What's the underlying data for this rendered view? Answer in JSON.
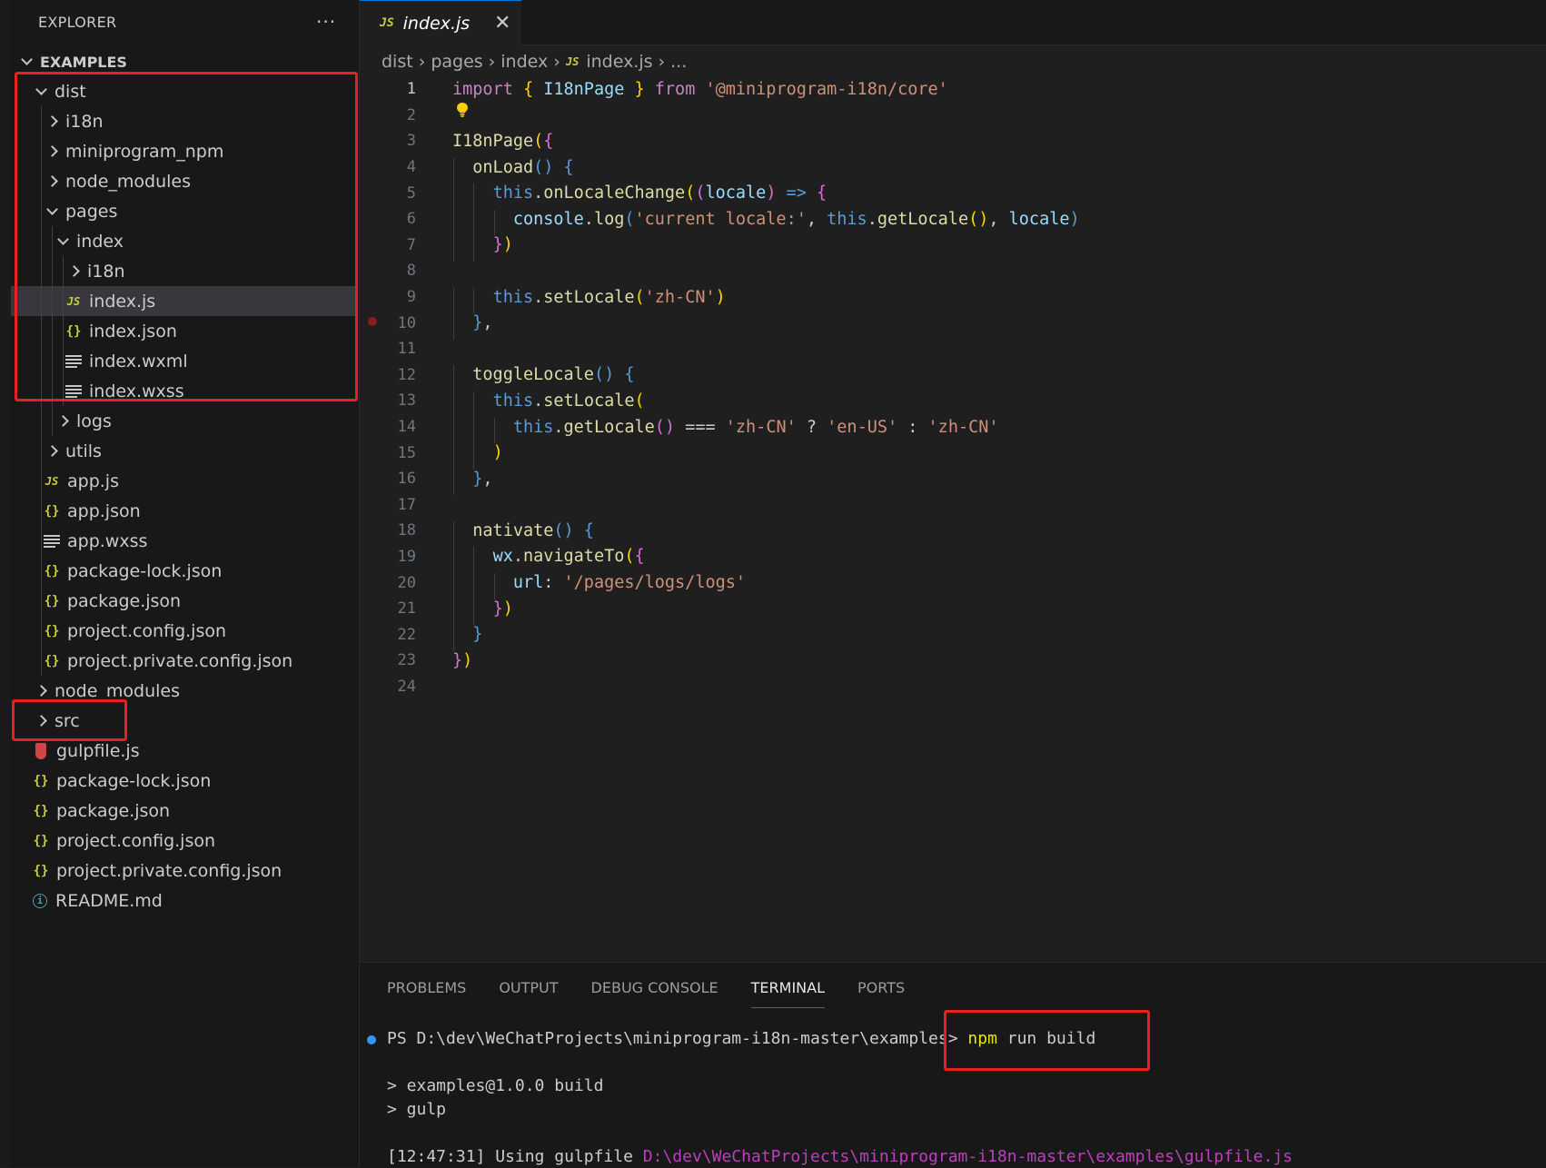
{
  "explorer": {
    "title": "EXPLORER",
    "more": "···",
    "workspace": "EXAMPLES"
  },
  "tree": [
    {
      "label": "dist",
      "depth": 0,
      "kind": "folder",
      "open": true
    },
    {
      "label": "i18n",
      "depth": 1,
      "kind": "folder",
      "open": false
    },
    {
      "label": "miniprogram_npm",
      "depth": 1,
      "kind": "folder",
      "open": false
    },
    {
      "label": "node_modules",
      "depth": 1,
      "kind": "folder",
      "open": false
    },
    {
      "label": "pages",
      "depth": 1,
      "kind": "folder",
      "open": true
    },
    {
      "label": "index",
      "depth": 2,
      "kind": "folder",
      "open": true
    },
    {
      "label": "i18n",
      "depth": 3,
      "kind": "folder",
      "open": false
    },
    {
      "label": "index.js",
      "depth": 3,
      "kind": "js",
      "selected": true
    },
    {
      "label": "index.json",
      "depth": 3,
      "kind": "json"
    },
    {
      "label": "index.wxml",
      "depth": 3,
      "kind": "lines"
    },
    {
      "label": "index.wxss",
      "depth": 3,
      "kind": "lines"
    },
    {
      "label": "logs",
      "depth": 2,
      "kind": "folder",
      "open": false
    },
    {
      "label": "utils",
      "depth": 1,
      "kind": "folder",
      "open": false
    },
    {
      "label": "app.js",
      "depth": 1,
      "kind": "js"
    },
    {
      "label": "app.json",
      "depth": 1,
      "kind": "json"
    },
    {
      "label": "app.wxss",
      "depth": 1,
      "kind": "lines"
    },
    {
      "label": "package-lock.json",
      "depth": 1,
      "kind": "json"
    },
    {
      "label": "package.json",
      "depth": 1,
      "kind": "json"
    },
    {
      "label": "project.config.json",
      "depth": 1,
      "kind": "json"
    },
    {
      "label": "project.private.config.json",
      "depth": 1,
      "kind": "json"
    },
    {
      "label": "node_modules",
      "depth": 0,
      "kind": "folder",
      "open": false
    },
    {
      "label": "src",
      "depth": 0,
      "kind": "folder",
      "open": false
    },
    {
      "label": "gulpfile.js",
      "depth": 0,
      "kind": "gulp"
    },
    {
      "label": "package-lock.json",
      "depth": 0,
      "kind": "json"
    },
    {
      "label": "package.json",
      "depth": 0,
      "kind": "json"
    },
    {
      "label": "project.config.json",
      "depth": 0,
      "kind": "json"
    },
    {
      "label": "project.private.config.json",
      "depth": 0,
      "kind": "json"
    },
    {
      "label": "README.md",
      "depth": 0,
      "kind": "info"
    }
  ],
  "icons": {
    "js": "JS",
    "json": "{}",
    "info": "i",
    "close": "✕"
  },
  "tab": {
    "label": "index.js",
    "badge": "JS"
  },
  "breadcrumb": [
    "dist",
    "pages",
    "index",
    "index.js",
    "..."
  ],
  "editor": {
    "active_line": 1,
    "breakpoint_line": 10,
    "lines": [
      [
        [
          "k",
          "import "
        ],
        [
          "y",
          "{ "
        ],
        [
          "v",
          "I18nPage"
        ],
        [
          "y",
          " } "
        ],
        [
          "k",
          "from "
        ],
        [
          "s",
          "'@miniprogram-i18n/core'"
        ]
      ],
      [],
      [
        [
          "f",
          "I18nPage"
        ],
        [
          "y",
          "("
        ],
        [
          "p",
          "{"
        ]
      ],
      [
        [
          "w",
          "  "
        ],
        [
          "f",
          "onLoad"
        ],
        [
          "b",
          "() {"
        ]
      ],
      [
        [
          "w",
          "    "
        ],
        [
          "b",
          "this"
        ],
        [
          "w",
          "."
        ],
        [
          "f",
          "onLocaleChange"
        ],
        [
          "y",
          "("
        ],
        [
          "p",
          "("
        ],
        [
          "v",
          "locale"
        ],
        [
          "p",
          ")"
        ],
        [
          "b",
          " => "
        ],
        [
          "p",
          "{"
        ]
      ],
      [
        [
          "w",
          "      "
        ],
        [
          "v",
          "console"
        ],
        [
          "w",
          "."
        ],
        [
          "f",
          "log"
        ],
        [
          "b",
          "("
        ],
        [
          "s",
          "'current locale:'"
        ],
        [
          "w",
          ", "
        ],
        [
          "b",
          "this"
        ],
        [
          "w",
          "."
        ],
        [
          "f",
          "getLocale"
        ],
        [
          "y",
          "()"
        ],
        [
          "w",
          ", "
        ],
        [
          "v",
          "locale"
        ],
        [
          "b",
          ")"
        ]
      ],
      [
        [
          "w",
          "    "
        ],
        [
          "p",
          "}"
        ],
        [
          "y",
          ")"
        ]
      ],
      [],
      [
        [
          "w",
          "    "
        ],
        [
          "b",
          "this"
        ],
        [
          "w",
          "."
        ],
        [
          "f",
          "setLocale"
        ],
        [
          "y",
          "("
        ],
        [
          "s",
          "'zh-CN'"
        ],
        [
          "y",
          ")"
        ]
      ],
      [
        [
          "w",
          "  "
        ],
        [
          "b",
          "}"
        ],
        [
          "w",
          ","
        ]
      ],
      [],
      [
        [
          "w",
          "  "
        ],
        [
          "f",
          "toggleLocale"
        ],
        [
          "b",
          "() {"
        ]
      ],
      [
        [
          "w",
          "    "
        ],
        [
          "b",
          "this"
        ],
        [
          "w",
          "."
        ],
        [
          "f",
          "setLocale"
        ],
        [
          "y",
          "("
        ]
      ],
      [
        [
          "w",
          "      "
        ],
        [
          "b",
          "this"
        ],
        [
          "w",
          "."
        ],
        [
          "f",
          "getLocale"
        ],
        [
          "p",
          "()"
        ],
        [
          "w",
          " === "
        ],
        [
          "s",
          "'zh-CN'"
        ],
        [
          "w",
          " ? "
        ],
        [
          "s",
          "'en-US'"
        ],
        [
          "w",
          " : "
        ],
        [
          "s",
          "'zh-CN'"
        ]
      ],
      [
        [
          "w",
          "    "
        ],
        [
          "y",
          ")"
        ]
      ],
      [
        [
          "w",
          "  "
        ],
        [
          "b",
          "}"
        ],
        [
          "w",
          ","
        ]
      ],
      [],
      [
        [
          "w",
          "  "
        ],
        [
          "f",
          "nativate"
        ],
        [
          "b",
          "() {"
        ]
      ],
      [
        [
          "w",
          "    "
        ],
        [
          "v",
          "wx"
        ],
        [
          "w",
          "."
        ],
        [
          "f",
          "navigateTo"
        ],
        [
          "y",
          "("
        ],
        [
          "p",
          "{"
        ]
      ],
      [
        [
          "w",
          "      "
        ],
        [
          "v",
          "url"
        ],
        [
          "w",
          ": "
        ],
        [
          "s",
          "'/pages/logs/logs'"
        ]
      ],
      [
        [
          "w",
          "    "
        ],
        [
          "p",
          "}"
        ],
        [
          "y",
          ")"
        ]
      ],
      [
        [
          "w",
          "  "
        ],
        [
          "b",
          "}"
        ]
      ],
      [
        [
          "p",
          "}"
        ],
        [
          "y",
          ")"
        ]
      ],
      []
    ]
  },
  "panel": {
    "tabs": [
      "PROBLEMS",
      "OUTPUT",
      "DEBUG CONSOLE",
      "TERMINAL",
      "PORTS"
    ],
    "active_tab": "TERMINAL",
    "prompt": "PS D:\\dev\\WeChatProjects\\miniprogram-i18n-master\\examples> ",
    "command_bin": "npm",
    "command_args": " run build",
    "output1": "> examples@1.0.0 build",
    "output2": "> gulp",
    "gulp_prefix": "[12:47:31] Using gulpfile ",
    "gulp_path": "D:\\dev\\WeChatProjects\\miniprogram-i18n-master\\examples\\gulpfile.js"
  },
  "colors": {
    "highlight_box": "#e8201f",
    "accent": "#0078d4",
    "js_icon": "#cbcb41"
  }
}
